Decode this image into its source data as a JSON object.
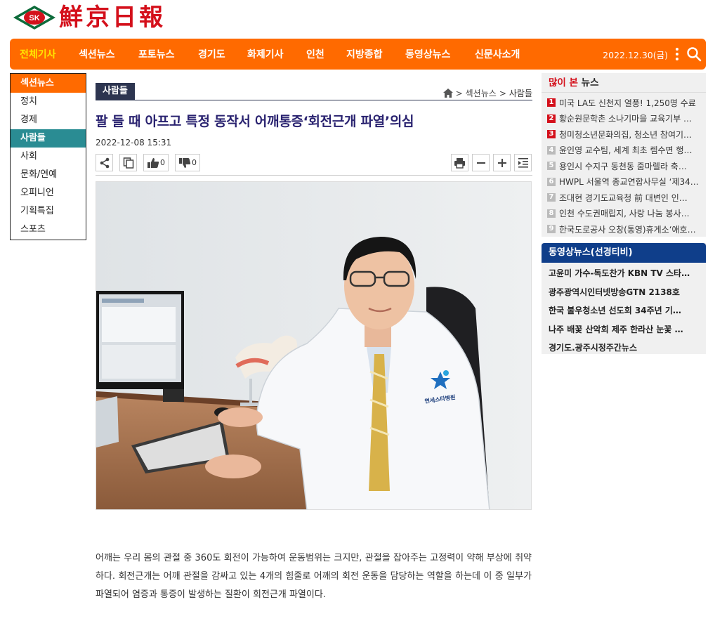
{
  "logo": {
    "mark_text": "SK",
    "name": "鮮京日報"
  },
  "topnav": {
    "items": [
      "전체기사",
      "섹션뉴스",
      "포토뉴스",
      "경기도",
      "화제기사",
      "인천",
      "지방종합",
      "동영상뉴스",
      "신문사소개"
    ],
    "date": "2022.12.30(금)"
  },
  "leftnav": {
    "head": "섹션뉴스",
    "items": [
      "정치",
      "경제",
      "사람들",
      "사회",
      "문화/연예",
      "오피니언",
      "기획특집",
      "스포츠"
    ],
    "active": "사람들"
  },
  "article": {
    "category": "사람들",
    "breadcrumb": [
      "섹션뉴스",
      "사람들"
    ],
    "title": "팔 들 때 아프고 특정 동작서 어깨통증‘회전근개 파열’의심",
    "date": "2022-12-08 15:31",
    "likes": "0",
    "dislikes": "0",
    "photo_logo_text": "연세스타병원",
    "body": "어깨는 우리 몸의 관절 중 360도 회전이 가능하여 운동범위는 크지만, 관절을 잡아주는 고정력이 약해 부상에 취약하다. 회전근개는 어깨 관절을 감싸고 있는 4개의 힘줄로 어깨의 회전 운동을 담당하는 역할을 하는데 이 중 일부가 파열되어 염증과 통증이 발생하는 질환이 회전근개 파열이다."
  },
  "popular": {
    "title_red": "많이 본",
    "title_rest": "뉴스",
    "items": [
      {
        "num": "1",
        "text": "미국 LA도 신천지 열풍! 1,250명 수료"
      },
      {
        "num": "2",
        "text": "황순원문학촌 소나기마을 교육기부 …"
      },
      {
        "num": "3",
        "text": "청미청소년문화의집, 청소년 참여기…"
      },
      {
        "num": "4",
        "text": "윤인영 교수팀, 세계 최초 렘수면 행…"
      },
      {
        "num": "5",
        "text": "용인시 수지구 동천동 줌마렐라 축…"
      },
      {
        "num": "6",
        "text": "HWPL 서울역 종교연합사무실 ‘제34…"
      },
      {
        "num": "7",
        "text": "조대현 경기도교육청 前 대변인 인…"
      },
      {
        "num": "8",
        "text": "인천 수도권매립지, 사랑 나눔 봉사…"
      },
      {
        "num": "9",
        "text": "한국도로공사 오창(통영)휴게소‘애호…"
      }
    ]
  },
  "video": {
    "title": "동영상뉴스(선경티비)",
    "items": [
      "고윤미 가수-독도찬가 KBN TV 스타…",
      "광주광역시인터넷방송GTN 2138호",
      "한국 불우청소년 선도회 34주년 기…",
      "나주 배꽃 산악회 제주 한라산 눈꽃 …",
      "경기도.광주시정주간뉴스"
    ]
  },
  "colors": {
    "orange": "#ff6a00",
    "navy": "#2d3550",
    "teal": "#2a8c93",
    "title": "#2a2370",
    "red": "#d4101b",
    "blue": "#0f3e8a"
  }
}
